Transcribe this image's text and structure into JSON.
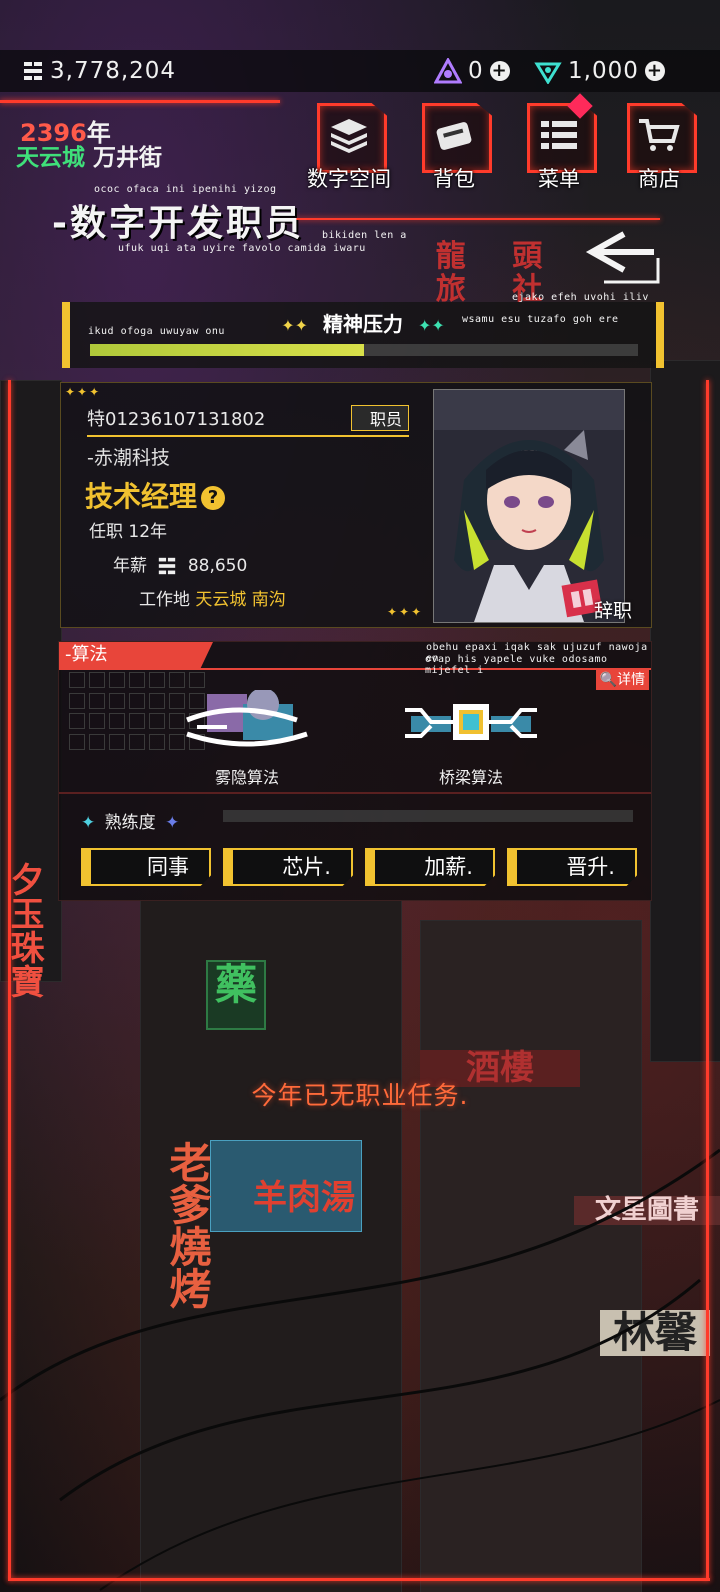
{
  "currency": {
    "money": "3,778,204",
    "gems_a": "0",
    "gems_b": "1,000"
  },
  "header": {
    "year": "2396",
    "year_unit": "年",
    "city": "天云城",
    "street": "万井街"
  },
  "nav": [
    {
      "label": "数字空间",
      "icon": "stack-icon"
    },
    {
      "label": "背包",
      "icon": "bag-icon"
    },
    {
      "label": "菜单",
      "icon": "menu-icon"
    },
    {
      "label": "商店",
      "icon": "cart-icon"
    }
  ],
  "page_title": "-数字开发职员",
  "deco_text": {
    "t1": "ococ ofaca ini ipenihi yizog",
    "t2": "ufuk uqi ata uyire favolo camida iwaru",
    "t3": "bikiden len a",
    "t4": "ejako efeh uvohi iliv",
    "t5": "wsamu esu tuzafo goh ere",
    "t6": "ikud ofoga uwuyaw onu",
    "t7": "obehu epaxi iqak sak ujuzuf nawoja en",
    "t8": "ovap his yapele vuke odosamo mijefel i"
  },
  "stress": {
    "title": "精神压力",
    "level": 0.5
  },
  "profile": {
    "id": "特01236107131802",
    "role_tag": "职员",
    "company": "-赤潮科技",
    "job_title": "技术经理",
    "tenure": "任职 12年",
    "salary_label": "年薪",
    "salary": "88,650",
    "workplace_label": "工作地",
    "workplace": "天云城 南沟",
    "resign_label": "辞职"
  },
  "algorithm": {
    "tab": "-算法",
    "details": "详情",
    "items": [
      {
        "label": "雾隐算法"
      },
      {
        "label": "桥梁算法"
      }
    ],
    "proficiency_label": "熟练度",
    "proficiency": 0.0,
    "buttons": [
      "同事",
      "芯片.",
      "加薪.",
      "晋升."
    ]
  },
  "notice": "今年已无职业任务.",
  "signs": {
    "s1": "龍 頭 旅 社",
    "s2": "老爹燒烤",
    "s3": "羊肉湯",
    "s4": "藥",
    "s5": "文星圖書",
    "s6": "林馨",
    "s7": "夕玉珠寶",
    "s8": "酒樓"
  },
  "colors": {
    "accent": "#f1c230",
    "frame": "#ff3b2b",
    "city": "#3fe07a",
    "year": "#ff5a4a"
  }
}
